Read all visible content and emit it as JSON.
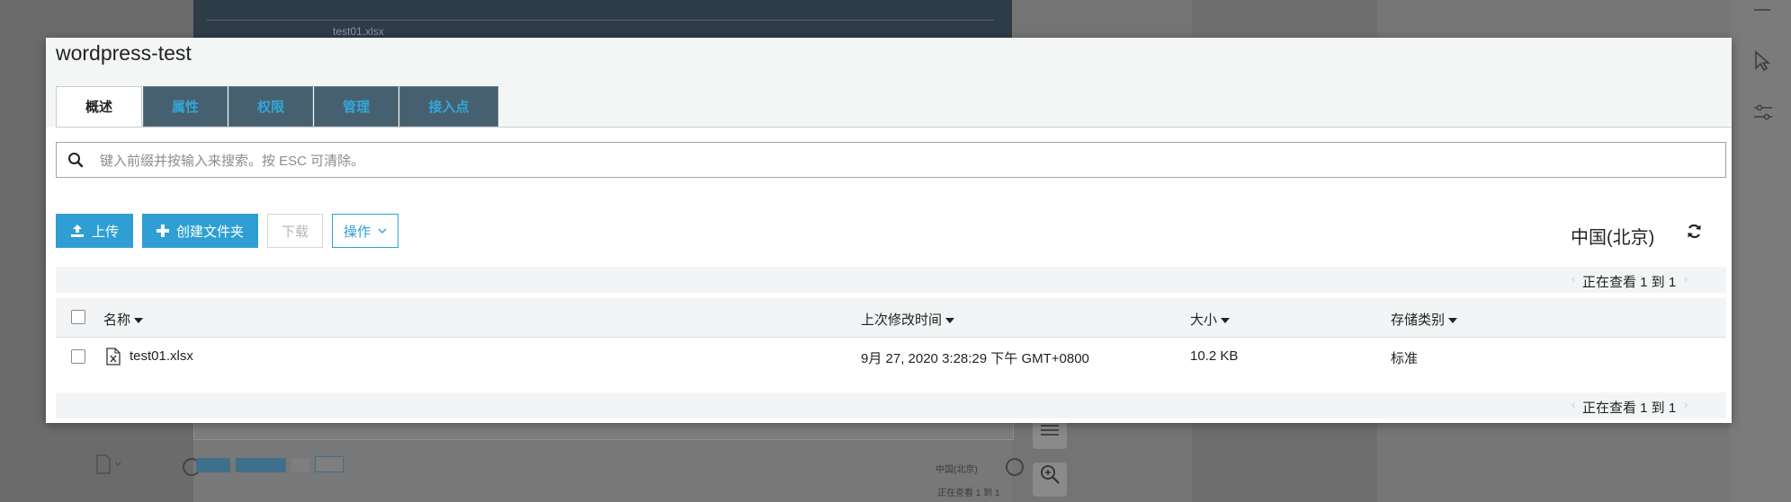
{
  "background": {
    "ghost_filename": "test01.xlsx",
    "ghost_region": "中国(北京)",
    "ghost_pager": "正在查看 1 到 1"
  },
  "modal": {
    "title": "wordpress-test",
    "tabs": [
      {
        "label": "概述",
        "active": true
      },
      {
        "label": "属性",
        "active": false
      },
      {
        "label": "权限",
        "active": false
      },
      {
        "label": "管理",
        "active": false
      },
      {
        "label": "接入点",
        "active": false
      }
    ],
    "search": {
      "placeholder": "键入前缀并按输入来搜索。按 ESC 可清除。",
      "value": ""
    },
    "toolbar": {
      "upload": "上传",
      "create_folder": "创建文件夹",
      "download": "下载",
      "actions": "操作"
    },
    "region": "中国(北京)",
    "pager_text": "正在查看 1 到 1",
    "table": {
      "columns": [
        "名称",
        "上次修改时间",
        "大小",
        "存储类别"
      ],
      "rows": [
        {
          "name": "test01.xlsx",
          "modified": "9月 27, 2020 3:28:29 下午 GMT+0800",
          "size": "10.2 KB",
          "storage_class": "标准"
        }
      ]
    }
  },
  "colors": {
    "accent": "#2f9fd3",
    "tab_bg": "#47606f",
    "tab_text": "#33a6d9",
    "overlay": "#737373"
  },
  "icons": [
    "search-icon",
    "upload-icon",
    "plus-icon",
    "chevron-down-icon",
    "refresh-icon",
    "file-excel-icon",
    "sort-caret-icon"
  ]
}
